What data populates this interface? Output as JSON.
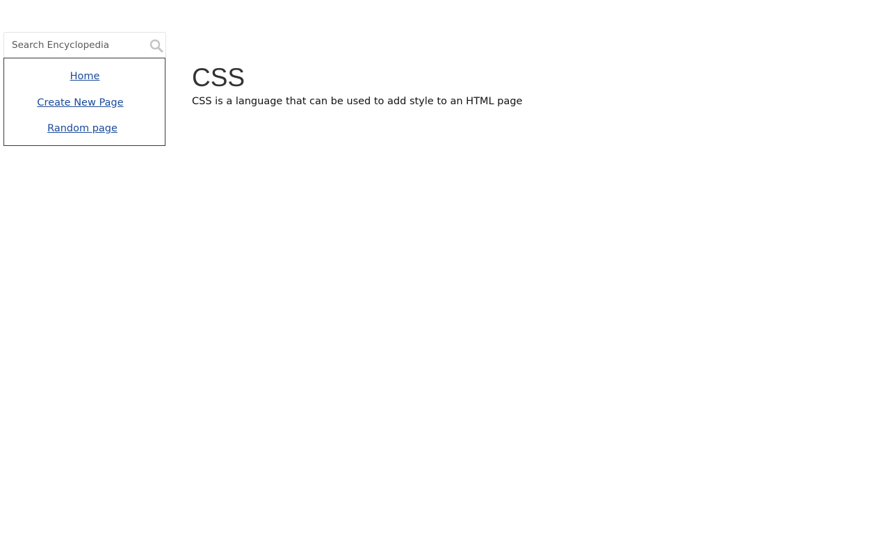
{
  "sidebar": {
    "search": {
      "placeholder": "Search Encyclopedia",
      "value": "",
      "icon": "search-icon"
    },
    "nav": [
      {
        "label": "Home"
      },
      {
        "label": "Create New Page"
      },
      {
        "label": "Random page"
      }
    ],
    "colors": {
      "link": "#1a4a9a",
      "border": "#3a3a3a"
    }
  },
  "main": {
    "title": "CSS",
    "body": "CSS is a language that can be used to add style to an HTML page"
  }
}
